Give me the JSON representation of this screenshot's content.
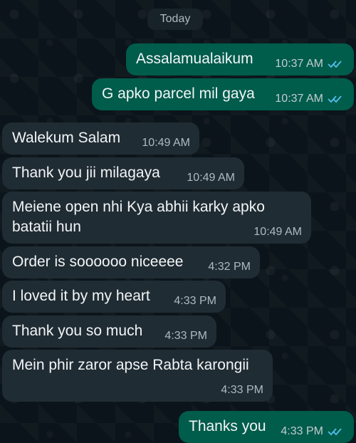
{
  "date_separator": "Today",
  "messages": [
    {
      "direction": "outgoing",
      "text": "Assalamualaikum",
      "time": "10:37 AM",
      "status_icon": "double-check-read-icon"
    },
    {
      "direction": "outgoing",
      "text": "G apko parcel mil gaya",
      "time": "10:37 AM",
      "status_icon": "double-check-read-icon"
    },
    {
      "direction": "incoming",
      "text": "Walekum Salam",
      "time": "10:49 AM"
    },
    {
      "direction": "incoming",
      "text": "Thank you jii milagaya",
      "time": "10:49 AM"
    },
    {
      "direction": "incoming",
      "text": "Meiene open nhi Kya abhii karky apko batatii hun",
      "time": "10:49 AM"
    },
    {
      "direction": "incoming",
      "text": "Order is soooooo niceeee",
      "time": "4:32 PM"
    },
    {
      "direction": "incoming",
      "text": "I loved it by my heart",
      "time": "4:33 PM"
    },
    {
      "direction": "incoming",
      "text": "Thank you so much",
      "time": "4:33 PM"
    },
    {
      "direction": "incoming",
      "text": "Mein phir zaror apse Rabta karongii",
      "time": "4:33 PM"
    },
    {
      "direction": "outgoing",
      "text": "Thanks you",
      "time": "4:33 PM",
      "status_icon": "double-check-read-icon"
    }
  ],
  "colors": {
    "background": "#0b141a",
    "incoming_bubble": "#202c33",
    "outgoing_bubble": "#005c4b",
    "read_ticks": "#53bdeb",
    "date_pill": "#182229"
  }
}
